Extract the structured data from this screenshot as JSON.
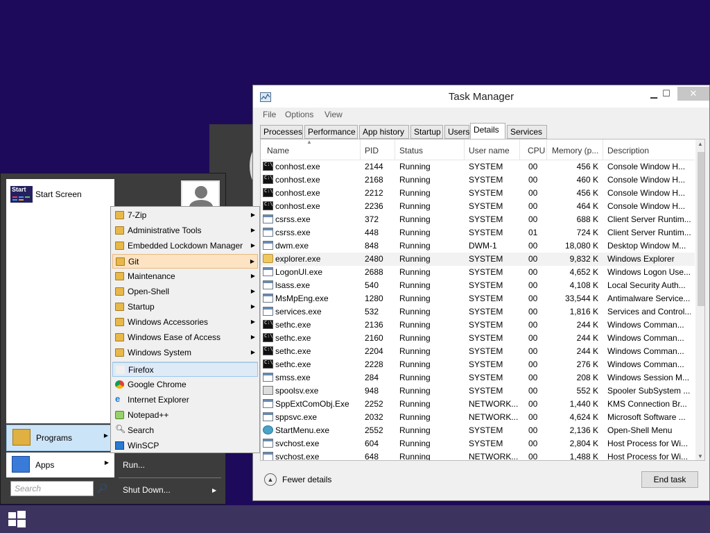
{
  "taskbar": {
    "start_icon": "windows-logo-icon"
  },
  "task_manager": {
    "title": "Task Manager",
    "controls": {
      "minimize": "▁",
      "maximize": "☐",
      "close": "✕"
    },
    "menu": [
      "File",
      "Options",
      "View"
    ],
    "tabs": [
      "Processes",
      "Performance",
      "App history",
      "Startup",
      "Users",
      "Details",
      "Services"
    ],
    "active_tab": "Details",
    "columns": [
      "Name",
      "PID",
      "Status",
      "User name",
      "CPU",
      "Memory (p...",
      "Description"
    ],
    "rows": [
      {
        "name": "conhost.exe",
        "pid": "2144",
        "status": "Running",
        "user": "SYSTEM",
        "cpu": "00",
        "mem": "456 K",
        "desc": "Console Window H...",
        "icon": "cmd"
      },
      {
        "name": "conhost.exe",
        "pid": "2168",
        "status": "Running",
        "user": "SYSTEM",
        "cpu": "00",
        "mem": "460 K",
        "desc": "Console Window H...",
        "icon": "cmd"
      },
      {
        "name": "conhost.exe",
        "pid": "2212",
        "status": "Running",
        "user": "SYSTEM",
        "cpu": "00",
        "mem": "456 K",
        "desc": "Console Window H...",
        "icon": "cmd"
      },
      {
        "name": "conhost.exe",
        "pid": "2236",
        "status": "Running",
        "user": "SYSTEM",
        "cpu": "00",
        "mem": "464 K",
        "desc": "Console Window H...",
        "icon": "cmd"
      },
      {
        "name": "csrss.exe",
        "pid": "372",
        "status": "Running",
        "user": "SYSTEM",
        "cpu": "00",
        "mem": "688 K",
        "desc": "Client Server Runtim...",
        "icon": "app"
      },
      {
        "name": "csrss.exe",
        "pid": "448",
        "status": "Running",
        "user": "SYSTEM",
        "cpu": "01",
        "mem": "724 K",
        "desc": "Client Server Runtim...",
        "icon": "app"
      },
      {
        "name": "dwm.exe",
        "pid": "848",
        "status": "Running",
        "user": "DWM-1",
        "cpu": "00",
        "mem": "18,080 K",
        "desc": "Desktop Window M...",
        "icon": "app"
      },
      {
        "name": "explorer.exe",
        "pid": "2480",
        "status": "Running",
        "user": "SYSTEM",
        "cpu": "00",
        "mem": "9,832 K",
        "desc": "Windows Explorer",
        "icon": "folder"
      },
      {
        "name": "LogonUI.exe",
        "pid": "2688",
        "status": "Running",
        "user": "SYSTEM",
        "cpu": "00",
        "mem": "4,652 K",
        "desc": "Windows Logon Use...",
        "icon": "app"
      },
      {
        "name": "lsass.exe",
        "pid": "540",
        "status": "Running",
        "user": "SYSTEM",
        "cpu": "00",
        "mem": "4,108 K",
        "desc": "Local Security Auth...",
        "icon": "app"
      },
      {
        "name": "MsMpEng.exe",
        "pid": "1280",
        "status": "Running",
        "user": "SYSTEM",
        "cpu": "00",
        "mem": "33,544 K",
        "desc": "Antimalware Service...",
        "icon": "app"
      },
      {
        "name": "services.exe",
        "pid": "532",
        "status": "Running",
        "user": "SYSTEM",
        "cpu": "00",
        "mem": "1,816 K",
        "desc": "Services and Control...",
        "icon": "app"
      },
      {
        "name": "sethc.exe",
        "pid": "2136",
        "status": "Running",
        "user": "SYSTEM",
        "cpu": "00",
        "mem": "244 K",
        "desc": "Windows Comman...",
        "icon": "cmd"
      },
      {
        "name": "sethc.exe",
        "pid": "2160",
        "status": "Running",
        "user": "SYSTEM",
        "cpu": "00",
        "mem": "244 K",
        "desc": "Windows Comman...",
        "icon": "cmd"
      },
      {
        "name": "sethc.exe",
        "pid": "2204",
        "status": "Running",
        "user": "SYSTEM",
        "cpu": "00",
        "mem": "244 K",
        "desc": "Windows Comman...",
        "icon": "cmd"
      },
      {
        "name": "sethc.exe",
        "pid": "2228",
        "status": "Running",
        "user": "SYSTEM",
        "cpu": "00",
        "mem": "276 K",
        "desc": "Windows Comman...",
        "icon": "cmd"
      },
      {
        "name": "smss.exe",
        "pid": "284",
        "status": "Running",
        "user": "SYSTEM",
        "cpu": "00",
        "mem": "208 K",
        "desc": "Windows Session M...",
        "icon": "app"
      },
      {
        "name": "spoolsv.exe",
        "pid": "948",
        "status": "Running",
        "user": "SYSTEM",
        "cpu": "00",
        "mem": "552 K",
        "desc": "Spooler SubSystem ...",
        "icon": "printer"
      },
      {
        "name": "SppExtComObj.Exe",
        "pid": "2252",
        "status": "Running",
        "user": "NETWORK...",
        "cpu": "00",
        "mem": "1,440 K",
        "desc": "KMS Connection Br...",
        "icon": "app"
      },
      {
        "name": "sppsvc.exe",
        "pid": "2032",
        "status": "Running",
        "user": "NETWORK...",
        "cpu": "00",
        "mem": "4,624 K",
        "desc": "Microsoft Software ...",
        "icon": "app"
      },
      {
        "name": "StartMenu.exe",
        "pid": "2552",
        "status": "Running",
        "user": "SYSTEM",
        "cpu": "00",
        "mem": "2,136 K",
        "desc": "Open-Shell Menu",
        "icon": "globe"
      },
      {
        "name": "svchost.exe",
        "pid": "604",
        "status": "Running",
        "user": "SYSTEM",
        "cpu": "00",
        "mem": "2,804 K",
        "desc": "Host Process for Wi...",
        "icon": "app"
      },
      {
        "name": "svchost.exe",
        "pid": "648",
        "status": "Running",
        "user": "NETWORK...",
        "cpu": "00",
        "mem": "1,488 K",
        "desc": "Host Process for Wi...",
        "icon": "app"
      }
    ],
    "selected_row": 7,
    "fewer_details": "Fewer details",
    "end_task": "End task"
  },
  "start_menu": {
    "start_screen_icon_text": "Start",
    "start_screen": "Start Screen",
    "programs": "Programs",
    "apps": "Apps",
    "search_placeholder": "Search",
    "run": "Run...",
    "shut_down": "Shut Down..."
  },
  "programs_submenu": {
    "folders": [
      "7-Zip",
      "Administrative Tools",
      "Embedded Lockdown Manager",
      "Git",
      "Maintenance",
      "Open-Shell",
      "Startup",
      "Windows Accessories",
      "Windows Ease of Access",
      "Windows System"
    ],
    "highlighted_folder": "Git",
    "items": [
      "Firefox",
      "Google Chrome",
      "Internet Explorer",
      "Notepad++",
      "Search",
      "WinSCP"
    ],
    "highlighted_item": "Firefox"
  }
}
